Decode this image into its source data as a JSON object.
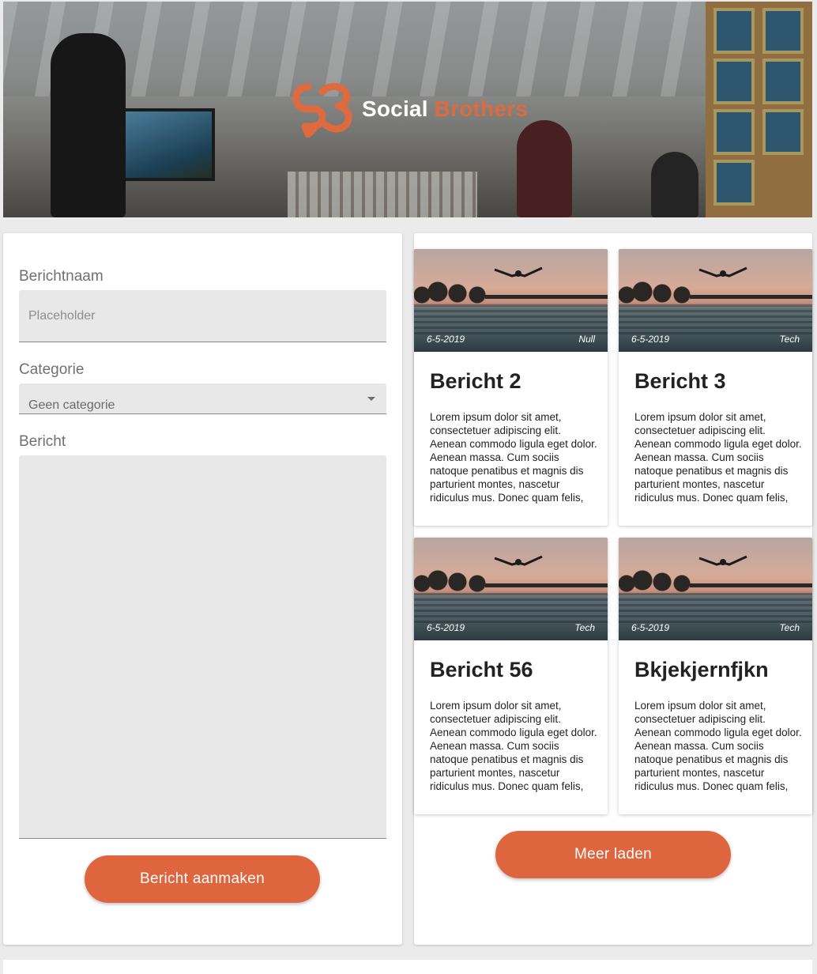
{
  "brand": {
    "name_part1": "Social",
    "name_part2": "Brothers"
  },
  "form": {
    "name_label": "Berichtnaam",
    "name_placeholder": "Placeholder",
    "category_label": "Categorie",
    "category_value": "Geen categorie",
    "message_label": "Bericht",
    "submit_label": "Bericht aanmaken"
  },
  "posts": [
    {
      "date": "6-5-2019",
      "category": "Null",
      "title": "Bericht 2",
      "body": "Lorem ipsum dolor sit amet, consectetuer adipiscing elit. Aenean commodo ligula eget dolor. Aenean massa. Cum sociis natoque penatibus et magnis dis parturient montes, nascetur ridiculus mus. Donec quam felis,"
    },
    {
      "date": "6-5-2019",
      "category": "Tech",
      "title": "Bericht 3",
      "body": "Lorem ipsum dolor sit amet, consectetuer adipiscing elit. Aenean commodo ligula eget dolor. Aenean massa. Cum sociis natoque penatibus et magnis dis parturient montes, nascetur ridiculus mus. Donec quam felis,"
    },
    {
      "date": "6-5-2019",
      "category": "Tech",
      "title": "Bericht 56",
      "body": "Lorem ipsum dolor sit amet, consectetuer adipiscing elit. Aenean commodo ligula eget dolor. Aenean massa. Cum sociis natoque penatibus et magnis dis parturient montes, nascetur ridiculus mus. Donec quam felis,"
    },
    {
      "date": "6-5-2019",
      "category": "Tech",
      "title": "Bkjekjernfjkn",
      "body": "Lorem ipsum dolor sit amet, consectetuer adipiscing elit. Aenean commodo ligula eget dolor. Aenean massa. Cum sociis natoque penatibus et magnis dis parturient montes, nascetur ridiculus mus. Donec quam felis,"
    }
  ],
  "load_more_label": "Meer laden",
  "colors": {
    "accent": "#de653d",
    "input_bg": "#e8e8e8",
    "page_bg": "#ebebeb"
  }
}
